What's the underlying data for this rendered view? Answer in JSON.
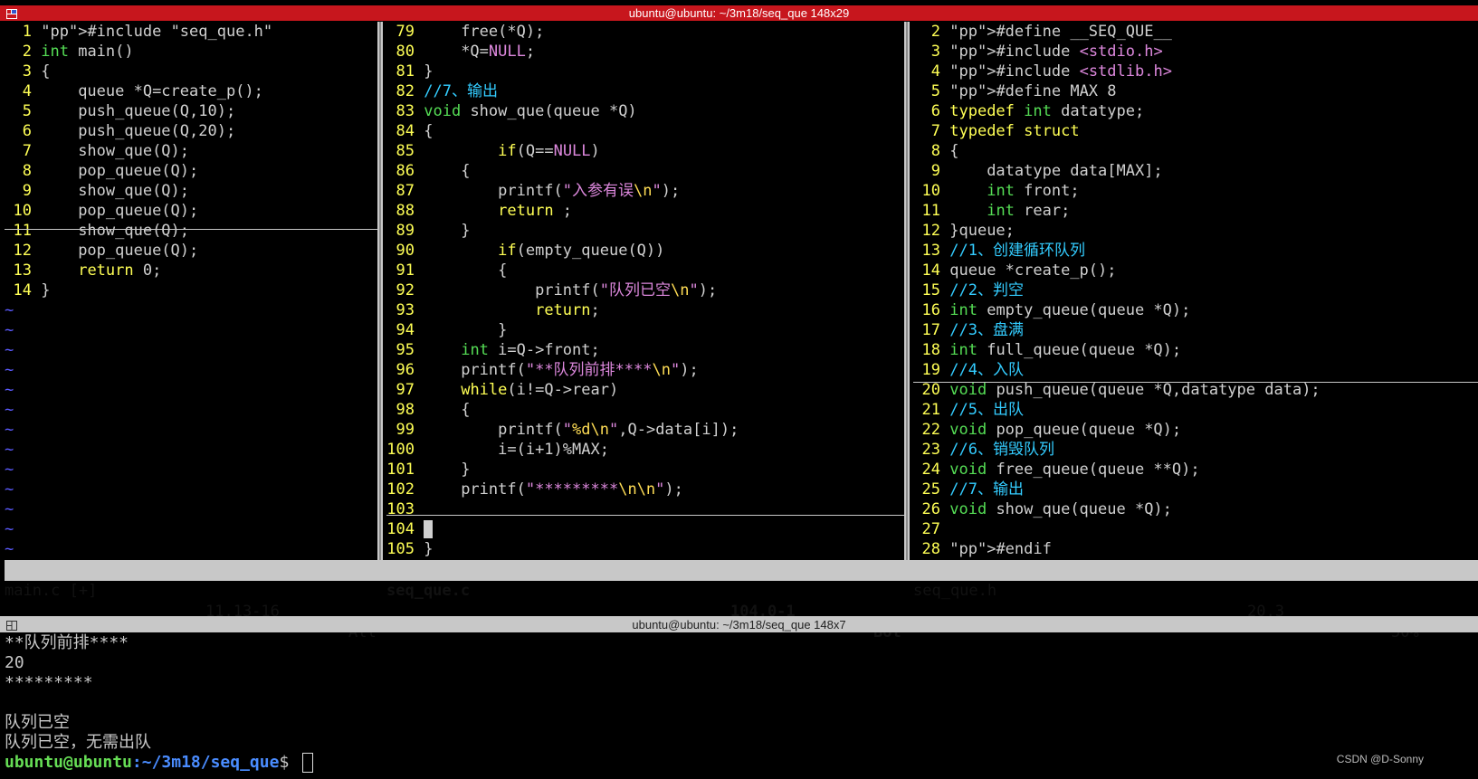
{
  "window": {
    "top_title": "ubuntu@ubuntu: ~/3m18/seq_que 148x29",
    "bottom_title": "ubuntu@ubuntu: ~/3m18/seq_que 148x7"
  },
  "panes": {
    "left": {
      "lines": [
        {
          "n": "1",
          "t": "#include \"seq_que.h\""
        },
        {
          "n": "2",
          "t": "int main()"
        },
        {
          "n": "3",
          "t": "{"
        },
        {
          "n": "4",
          "t": "    queue *Q=create_p();"
        },
        {
          "n": "5",
          "t": "    push_queue(Q,10);"
        },
        {
          "n": "6",
          "t": "    push_queue(Q,20);"
        },
        {
          "n": "7",
          "t": "    show_que(Q);"
        },
        {
          "n": "8",
          "t": "    pop_queue(Q);"
        },
        {
          "n": "9",
          "t": "    show_que(Q);"
        },
        {
          "n": "10",
          "t": "    pop_queue(Q);"
        },
        {
          "n": "11",
          "t": "    show_que(Q);"
        },
        {
          "n": "12",
          "t": "    pop_queue(Q);"
        },
        {
          "n": "13",
          "t": "    return 0;"
        },
        {
          "n": "14",
          "t": "}"
        }
      ],
      "tilde": "~",
      "status_file": "main.c [+]",
      "status_pos": "11,13-16",
      "status_scroll": "All"
    },
    "middle": {
      "lines": [
        {
          "n": "79",
          "t": "    free(*Q);"
        },
        {
          "n": "80",
          "t": "    *Q=NULL;"
        },
        {
          "n": "81",
          "t": "}"
        },
        {
          "n": "82",
          "t": "//7、输出"
        },
        {
          "n": "83",
          "t": "void show_que(queue *Q)"
        },
        {
          "n": "84",
          "t": "{"
        },
        {
          "n": "85",
          "t": "        if(Q==NULL)"
        },
        {
          "n": "86",
          "t": "    {"
        },
        {
          "n": "87",
          "t": "        printf(\"入参有误\\n\");"
        },
        {
          "n": "88",
          "t": "        return ;"
        },
        {
          "n": "89",
          "t": "    }"
        },
        {
          "n": "90",
          "t": "        if(empty_queue(Q))"
        },
        {
          "n": "91",
          "t": "        {"
        },
        {
          "n": "92",
          "t": "            printf(\"队列已空\\n\");"
        },
        {
          "n": "93",
          "t": "            return;"
        },
        {
          "n": "94",
          "t": "        }"
        },
        {
          "n": "95",
          "t": "    int i=Q->front;"
        },
        {
          "n": "96",
          "t": "    printf(\"**队列前排****\\n\");"
        },
        {
          "n": "97",
          "t": "    while(i!=Q->rear)"
        },
        {
          "n": "98",
          "t": "    {"
        },
        {
          "n": "99",
          "t": "        printf(\"%d\\n\",Q->data[i]);"
        },
        {
          "n": "100",
          "t": "        i=(i+1)%MAX;"
        },
        {
          "n": "101",
          "t": "    }"
        },
        {
          "n": "102",
          "t": "    printf(\"*********\\n\\n\");"
        },
        {
          "n": "103",
          "t": ""
        },
        {
          "n": "104",
          "t": ""
        },
        {
          "n": "105",
          "t": "}"
        }
      ],
      "status_file": "seq_que.c",
      "status_pos": "104,0-1",
      "status_scroll": "Bot"
    },
    "right": {
      "lines": [
        {
          "n": "2",
          "t": "#define __SEQ_QUE__"
        },
        {
          "n": "3",
          "t": "#include <stdio.h>"
        },
        {
          "n": "4",
          "t": "#include <stdlib.h>"
        },
        {
          "n": "5",
          "t": "#define MAX 8"
        },
        {
          "n": "6",
          "t": "typedef int datatype;"
        },
        {
          "n": "7",
          "t": "typedef struct"
        },
        {
          "n": "8",
          "t": "{"
        },
        {
          "n": "9",
          "t": "    datatype data[MAX];"
        },
        {
          "n": "10",
          "t": "    int front;"
        },
        {
          "n": "11",
          "t": "    int rear;"
        },
        {
          "n": "12",
          "t": "}queue;"
        },
        {
          "n": "13",
          "t": "//1、创建循环队列"
        },
        {
          "n": "14",
          "t": "queue *create_p();"
        },
        {
          "n": "15",
          "t": "//2、判空"
        },
        {
          "n": "16",
          "t": "int empty_queue(queue *Q);"
        },
        {
          "n": "17",
          "t": "//3、盘满"
        },
        {
          "n": "18",
          "t": "int full_queue(queue *Q);"
        },
        {
          "n": "19",
          "t": "//4、入队"
        },
        {
          "n": "20",
          "t": "void push_queue(queue *Q,datatype data);"
        },
        {
          "n": "21",
          "t": "//5、出队"
        },
        {
          "n": "22",
          "t": "void pop_queue(queue *Q);"
        },
        {
          "n": "23",
          "t": "//6、销毁队列"
        },
        {
          "n": "24",
          "t": "void free_queue(queue **Q);"
        },
        {
          "n": "25",
          "t": "//7、输出"
        },
        {
          "n": "26",
          "t": "void show_que(queue *Q);"
        },
        {
          "n": "27",
          "t": ""
        },
        {
          "n": "28",
          "t": "#endif"
        }
      ],
      "status_file": "seq_que.h",
      "status_pos": "20,3",
      "status_scroll": "50%"
    }
  },
  "terminal": {
    "output": [
      "**队列前排****",
      "20",
      "*********",
      "",
      "队列已空",
      "队列已空，无需出队"
    ],
    "prompt_user": "ubuntu@ubuntu",
    "prompt_path": ":~/3m18/seq_que",
    "prompt_symbol": "$ "
  },
  "watermark": "CSDN @D-Sonny",
  "colors": {
    "title_bar": "#c7161d",
    "line_number": "#ffff55",
    "comment": "#33ccff",
    "string": "#dd88dd",
    "keyword": "#ffff55",
    "type": "#55dd55"
  }
}
